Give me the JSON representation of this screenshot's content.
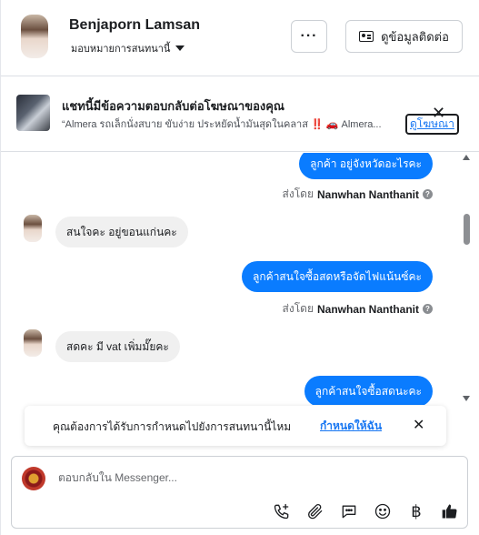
{
  "header": {
    "contact_name": "Benjaporn Lamsan",
    "assign_label": "มอบหมายการสนทนานี้",
    "more_label": "···",
    "contact_info_label": "ดูข้อมูลติดต่อ"
  },
  "ad_banner": {
    "title": "แชทนี้มีข้อความตอบกลับต่อโฆษณาของคุณ",
    "text": "“Almera รถเล็กนั่งสบาย ขับง่าย ประหยัดน้ำมันสุดในคลาส ‼️ 🚗 Almera...",
    "view_ad_label": "ดูโฆษณา",
    "close_label": "✕"
  },
  "messages": [
    {
      "direction": "outgoing",
      "text": "ลูกค้า อยู่จังหวัดอะไรคะ"
    },
    {
      "type": "sent_by",
      "prefix": "ส่งโดย",
      "name": "Nanwhan Nanthanit"
    },
    {
      "direction": "incoming",
      "text": "สนใจคะ อยู่ขอนแก่นคะ"
    },
    {
      "direction": "outgoing",
      "text": "ลูกค้าสนใจซื้อสดหรือจัดไฟแน้นซ์คะ"
    },
    {
      "type": "sent_by",
      "prefix": "ส่งโดย",
      "name": "Nanwhan Nanthanit"
    },
    {
      "direction": "incoming",
      "text": "สดคะ มี vat เพิ่มมั๊ยคะ"
    },
    {
      "direction": "outgoing",
      "text": "ลูกค้าสนใจซื้อสดนะคะ"
    }
  ],
  "reminder": {
    "question": "คุณต้องการได้รับการกำหนดไปยังการสนทนานี้ไหม",
    "action_label": "กำหนดให้ฉัน",
    "close_label": "✕"
  },
  "composer": {
    "placeholder": "ตอบกลับใน Messenger...",
    "tools": [
      "add-call-icon",
      "attachment-icon",
      "saved-reply-icon",
      "emoji-icon",
      "baht-payment-icon",
      "thumbs-up-icon"
    ],
    "baht_symbol": "฿"
  },
  "colors": {
    "outgoing_bubble": "#0a7cff",
    "incoming_bubble": "#f0f0f0",
    "link": "#1877f2"
  }
}
